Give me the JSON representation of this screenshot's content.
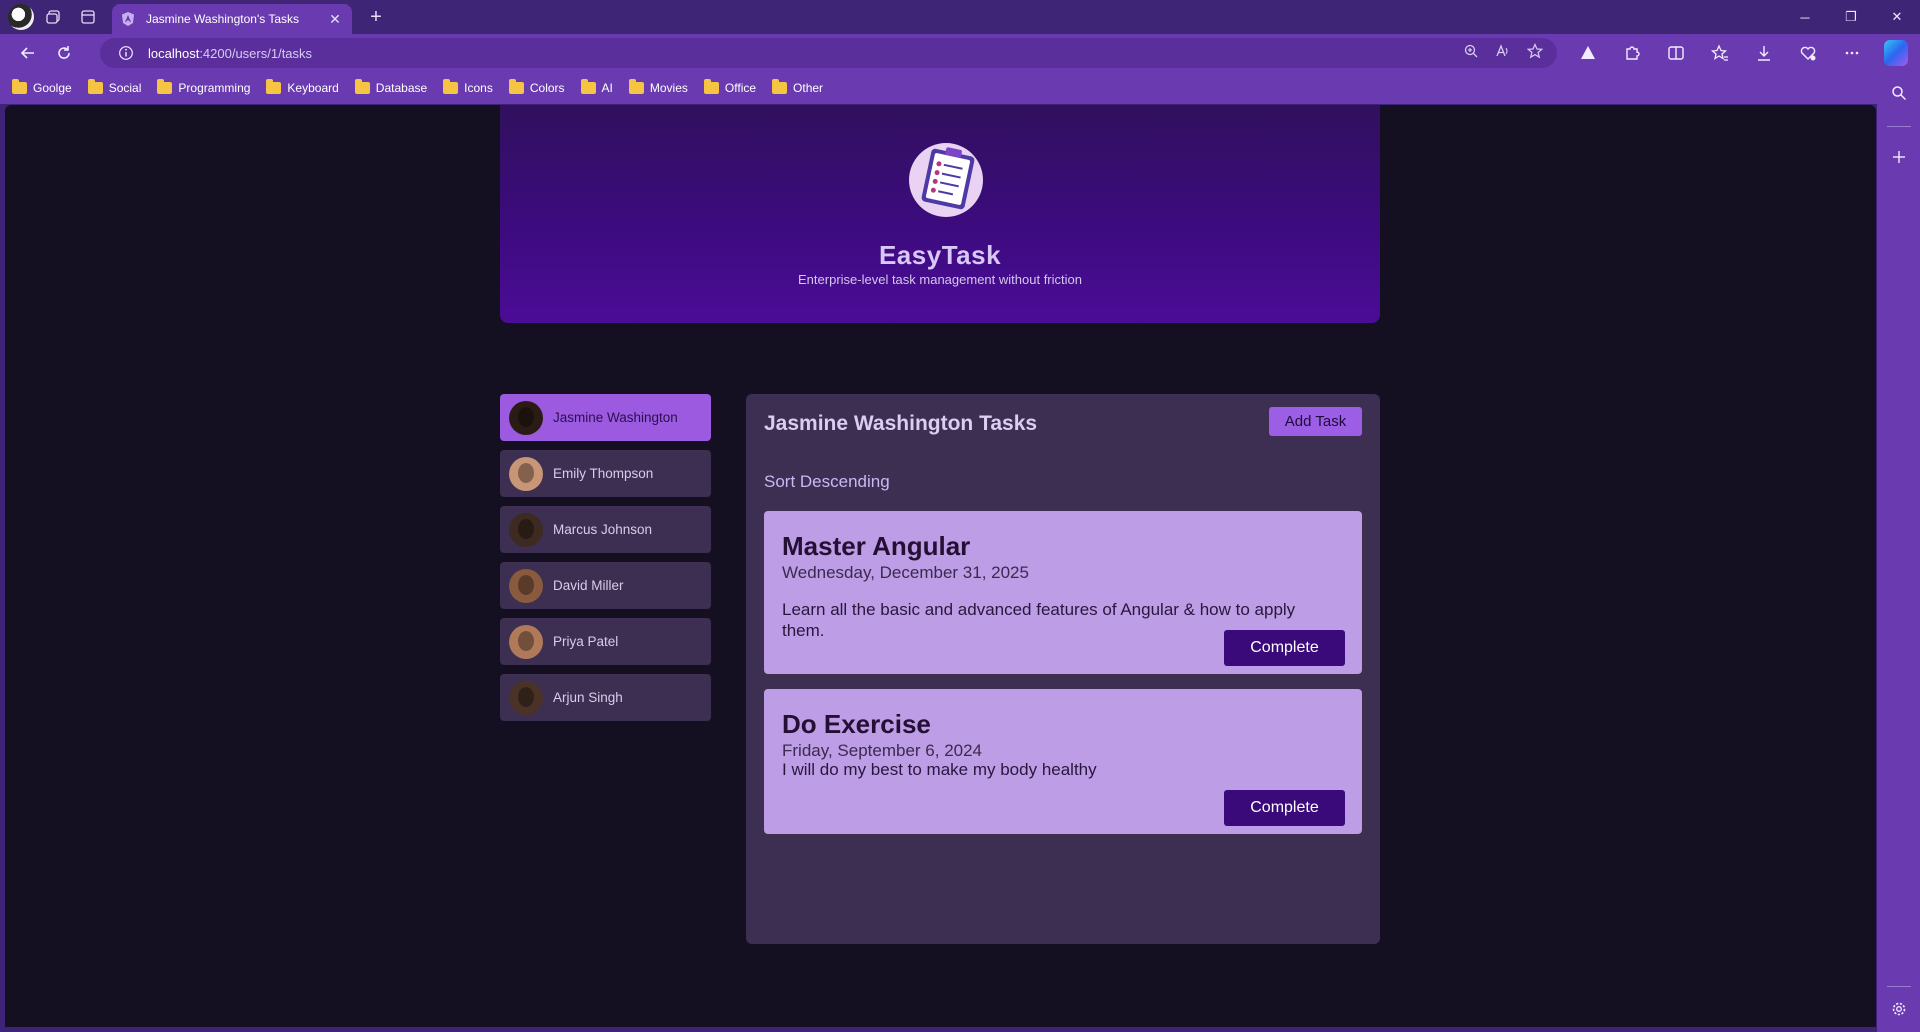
{
  "browser": {
    "tab_title": "Jasmine Washington's Tasks",
    "url_host": "localhost",
    "url_path": ":4200/users/1/tasks",
    "bookmarks": [
      "Goolge",
      "Social",
      "Programming",
      "Keyboard",
      "Database",
      "Icons",
      "Colors",
      "AI",
      "Movies",
      "Office",
      "Other"
    ]
  },
  "app": {
    "title": "EasyTask",
    "subtitle": "Enterprise-level task management without friction"
  },
  "users": [
    {
      "name": "Jasmine Washington",
      "active": true,
      "avatar_color": "#2a1c14"
    },
    {
      "name": "Emily Thompson",
      "active": false,
      "avatar_color": "#c99577"
    },
    {
      "name": "Marcus Johnson",
      "active": false,
      "avatar_color": "#3d2a20"
    },
    {
      "name": "David Miller",
      "active": false,
      "avatar_color": "#8a5a3e"
    },
    {
      "name": "Priya Patel",
      "active": false,
      "avatar_color": "#b07a5a"
    },
    {
      "name": "Arjun Singh",
      "active": false,
      "avatar_color": "#4a3326"
    }
  ],
  "tasks_panel": {
    "title": "Jasmine Washington Tasks",
    "add_label": "Add Task",
    "sort_label": "Sort Descending",
    "tasks": [
      {
        "title": "Master Angular",
        "date": "Wednesday, December 31, 2025",
        "summary": "Learn all the basic and advanced features of Angular & how to apply them.",
        "button": "Complete"
      },
      {
        "title": "Do Exercise",
        "date": "Friday, September 6, 2024",
        "summary": "I will do my best to make my body healthy",
        "button": "Complete"
      }
    ]
  },
  "colors": {
    "chrome": "#6a3bb0",
    "tab_strip": "#3e2576",
    "page_bg": "#141021",
    "panel": "#3c2f52",
    "active_user": "#9b5ae0",
    "card": "#bc9de6",
    "complete_btn": "#3a0a7a"
  }
}
